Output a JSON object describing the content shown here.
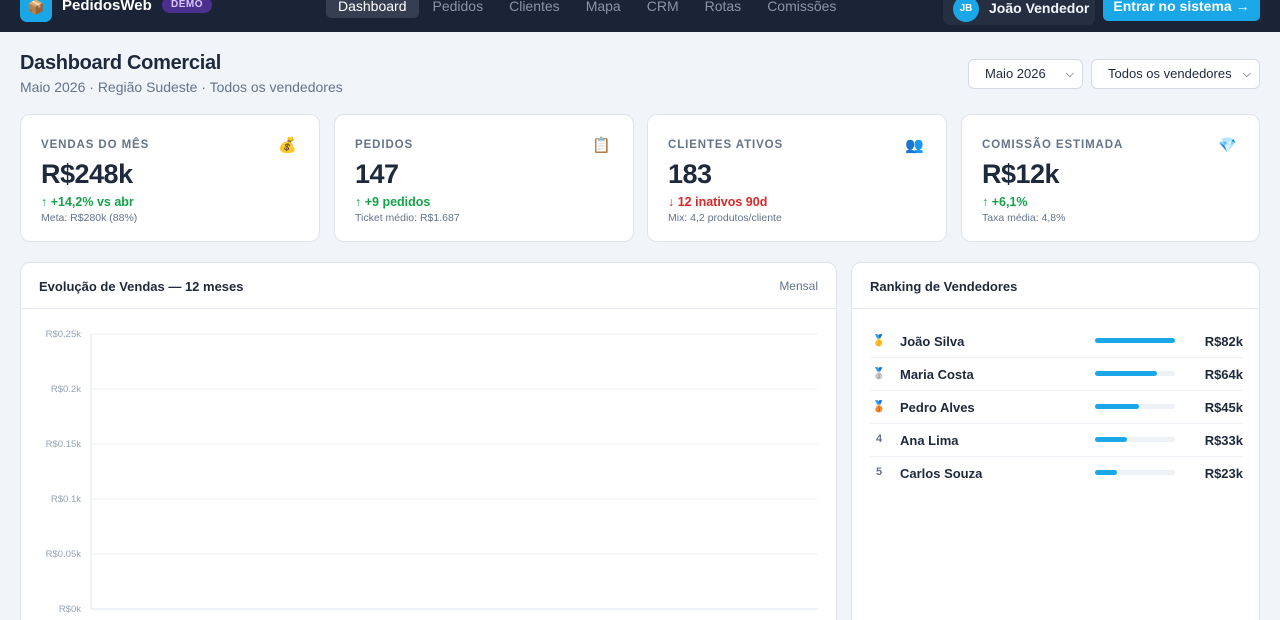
{
  "app": {
    "logo_icon": "📦",
    "brand": "PedidosWeb",
    "badge": "DEMO"
  },
  "nav": [
    {
      "label": "Dashboard",
      "active": true
    },
    {
      "label": "Pedidos",
      "active": false
    },
    {
      "label": "Clientes",
      "active": false
    },
    {
      "label": "Mapa",
      "active": false
    },
    {
      "label": "CRM",
      "active": false
    },
    {
      "label": "Rotas",
      "active": false
    },
    {
      "label": "Comissões",
      "active": false
    }
  ],
  "user": {
    "initials": "JB",
    "name": "João Vendedor"
  },
  "login_label": "Entrar no sistema →",
  "header": {
    "title": "Dashboard Comercial",
    "subtitle": "Maio 2026 · Região Sudeste · Todos os vendedores",
    "month_select": "Maio 2026",
    "seller_select": "Todos os vendedores"
  },
  "kpis": [
    {
      "label": "VENDAS DO MÊS",
      "icon": "💰",
      "value": "R$248k",
      "delta": "↑ +14,2% vs abr",
      "trend": "up",
      "note": "Meta: R$280k (88%)"
    },
    {
      "label": "PEDIDOS",
      "icon": "📋",
      "value": "147",
      "delta": "↑ +9 pedidos",
      "trend": "up",
      "note": "Ticket médio: R$1.687"
    },
    {
      "label": "CLIENTES ATIVOS",
      "icon": "👥",
      "value": "183",
      "delta": "↓ 12 inativos 90d",
      "trend": "down",
      "note": "Mix: 4,2 produtos/cliente"
    },
    {
      "label": "COMISSÃO ESTIMADA",
      "icon": "💎",
      "value": "R$12k",
      "delta": "↑ +6,1%",
      "trend": "up",
      "note": "Taxa média: 4,8%"
    }
  ],
  "sales_panel": {
    "title": "Evolução de Vendas — 12 meses",
    "period": "Mensal"
  },
  "chart_data": {
    "type": "line",
    "title": "Evolução de Vendas — 12 meses",
    "ylim": [
      0,
      0.25
    ],
    "y_ticks": [
      0,
      0.05,
      0.1,
      0.15,
      0.2,
      0.25
    ],
    "y_tick_labels": [
      "R$0k",
      "R$0.05k",
      "R$0.1k",
      "R$0.15k",
      "R$0.2k",
      "R$0.25k"
    ],
    "grid": true,
    "series": []
  },
  "ranking": {
    "title": "Ranking de Vendedores",
    "max_value": 82,
    "rows": [
      {
        "pos": "🥇",
        "name": "João Silva",
        "value": 82,
        "value_label": "R$82k"
      },
      {
        "pos": "🥈",
        "name": "Maria Costa",
        "value": 64,
        "value_label": "R$64k"
      },
      {
        "pos": "🥉",
        "name": "Pedro Alves",
        "value": 45,
        "value_label": "R$45k"
      },
      {
        "pos": "4",
        "name": "Ana Lima",
        "value": 33,
        "value_label": "R$33k"
      },
      {
        "pos": "5",
        "name": "Carlos Souza",
        "value": 23,
        "value_label": "R$23k"
      }
    ]
  },
  "colors": {
    "topbar": "#1b2436",
    "accent": "#1aa7e8",
    "up": "#16a34a",
    "down": "#dc2626"
  }
}
